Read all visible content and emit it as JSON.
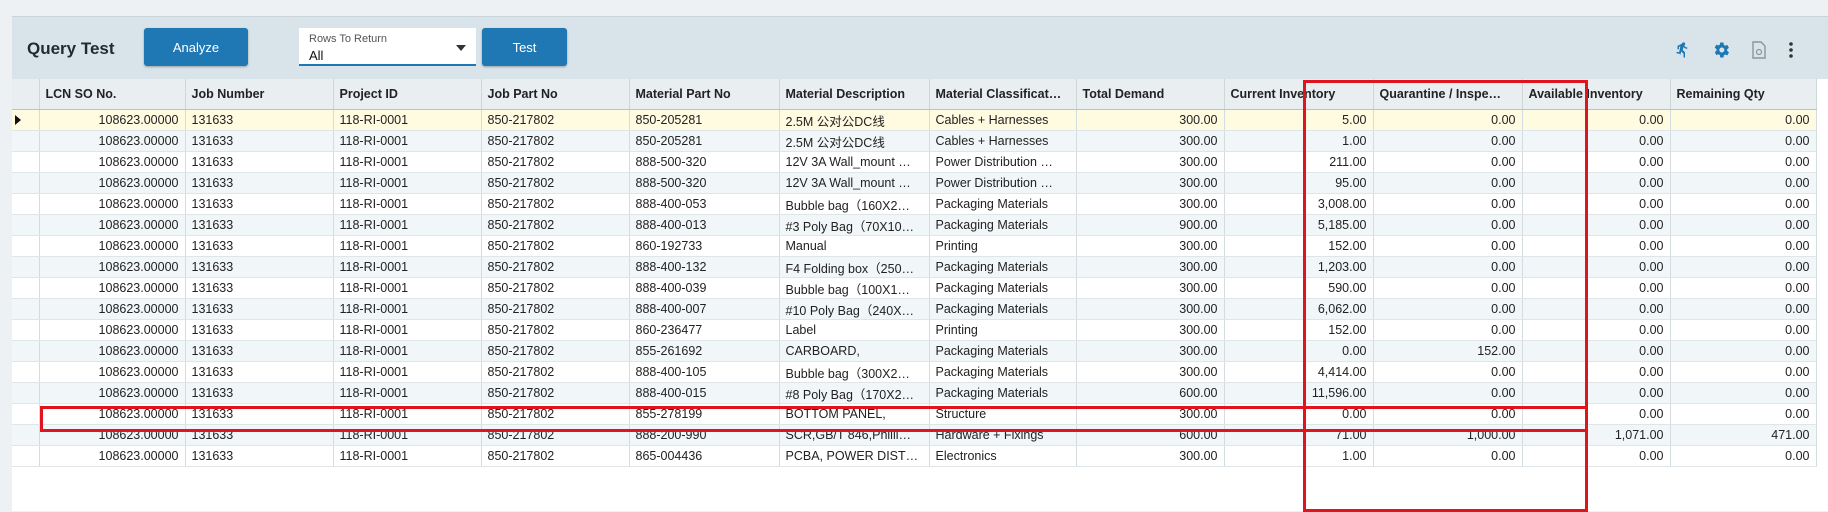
{
  "header": {
    "title": "Query Test",
    "analyze_label": "Analyze",
    "rows_to_return": {
      "label": "Rows To Return",
      "value": "All"
    },
    "test_label": "Test",
    "icons": [
      "run-icon",
      "gear-icon",
      "document-icon",
      "more-vert-icon"
    ]
  },
  "grid": {
    "columns": [
      "LCN SO No.",
      "Job Number",
      "Project ID",
      "Job Part No",
      "Material Part No",
      "Material Description",
      "Material Classificat…",
      "Total Demand",
      "Current Inventory",
      "Quarantine / Inspe…",
      "Available Inventory",
      "Remaining Qty"
    ],
    "rows": [
      [
        "108623.00000",
        "131633",
        "118-RI-0001",
        "850-217802",
        "850-205281",
        "2.5M 公对公DC线",
        "Cables + Harnesses",
        "300.00",
        "5.00",
        "0.00",
        "0.00",
        "0.00"
      ],
      [
        "108623.00000",
        "131633",
        "118-RI-0001",
        "850-217802",
        "850-205281",
        "2.5M 公对公DC线",
        "Cables + Harnesses",
        "300.00",
        "1.00",
        "0.00",
        "0.00",
        "0.00"
      ],
      [
        "108623.00000",
        "131633",
        "118-RI-0001",
        "850-217802",
        "888-500-320",
        "12V 3A Wall_mount …",
        "Power Distribution …",
        "300.00",
        "211.00",
        "0.00",
        "0.00",
        "0.00"
      ],
      [
        "108623.00000",
        "131633",
        "118-RI-0001",
        "850-217802",
        "888-500-320",
        "12V 3A Wall_mount …",
        "Power Distribution …",
        "300.00",
        "95.00",
        "0.00",
        "0.00",
        "0.00"
      ],
      [
        "108623.00000",
        "131633",
        "118-RI-0001",
        "850-217802",
        "888-400-053",
        "Bubble bag（160X2…",
        "Packaging Materials",
        "300.00",
        "3,008.00",
        "0.00",
        "0.00",
        "0.00"
      ],
      [
        "108623.00000",
        "131633",
        "118-RI-0001",
        "850-217802",
        "888-400-013",
        "#3 Poly Bag（70X10…",
        "Packaging Materials",
        "900.00",
        "5,185.00",
        "0.00",
        "0.00",
        "0.00"
      ],
      [
        "108623.00000",
        "131633",
        "118-RI-0001",
        "850-217802",
        "860-192733",
        "Manual",
        "Printing",
        "300.00",
        "152.00",
        "0.00",
        "0.00",
        "0.00"
      ],
      [
        "108623.00000",
        "131633",
        "118-RI-0001",
        "850-217802",
        "888-400-132",
        "F4 Folding box（250…",
        "Packaging Materials",
        "300.00",
        "1,203.00",
        "0.00",
        "0.00",
        "0.00"
      ],
      [
        "108623.00000",
        "131633",
        "118-RI-0001",
        "850-217802",
        "888-400-039",
        "Bubble bag（100X1…",
        "Packaging Materials",
        "300.00",
        "590.00",
        "0.00",
        "0.00",
        "0.00"
      ],
      [
        "108623.00000",
        "131633",
        "118-RI-0001",
        "850-217802",
        "888-400-007",
        "#10 Poly Bag（240X…",
        "Packaging Materials",
        "300.00",
        "6,062.00",
        "0.00",
        "0.00",
        "0.00"
      ],
      [
        "108623.00000",
        "131633",
        "118-RI-0001",
        "850-217802",
        "860-236477",
        "Label",
        "Printing",
        "300.00",
        "152.00",
        "0.00",
        "0.00",
        "0.00"
      ],
      [
        "108623.00000",
        "131633",
        "118-RI-0001",
        "850-217802",
        "855-261692",
        "CARBOARD,",
        "Packaging Materials",
        "300.00",
        "0.00",
        "152.00",
        "0.00",
        "0.00"
      ],
      [
        "108623.00000",
        "131633",
        "118-RI-0001",
        "850-217802",
        "888-400-105",
        "Bubble bag（300X2…",
        "Packaging Materials",
        "300.00",
        "4,414.00",
        "0.00",
        "0.00",
        "0.00"
      ],
      [
        "108623.00000",
        "131633",
        "118-RI-0001",
        "850-217802",
        "888-400-015",
        "#8 Poly Bag（170X2…",
        "Packaging Materials",
        "600.00",
        "11,596.00",
        "0.00",
        "0.00",
        "0.00"
      ],
      [
        "108623.00000",
        "131633",
        "118-RI-0001",
        "850-217802",
        "855-278199",
        "BOTTOM PANEL,",
        "Structure",
        "300.00",
        "0.00",
        "0.00",
        "0.00",
        "0.00"
      ],
      [
        "108623.00000",
        "131633",
        "118-RI-0001",
        "850-217802",
        "888-200-990",
        "SCR,GB/T 846,Philli…",
        "Hardware + Fixings",
        "600.00",
        "71.00",
        "1,000.00",
        "1,071.00",
        "471.00"
      ],
      [
        "108623.00000",
        "131633",
        "118-RI-0001",
        "850-217802",
        "865-004436",
        "PCBA, POWER DISTR…",
        "Electronics",
        "300.00",
        "1.00",
        "0.00",
        "0.00",
        "0.00"
      ]
    ]
  }
}
